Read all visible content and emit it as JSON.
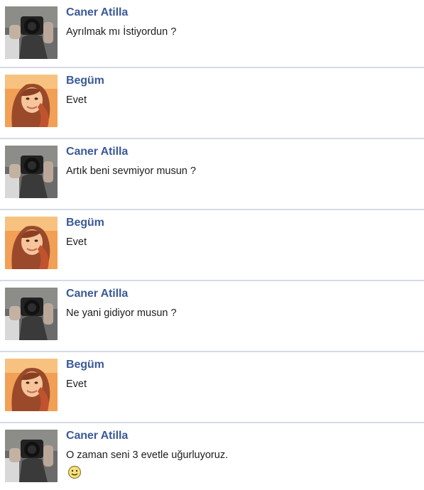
{
  "messages": [
    {
      "author": "Caner Atilla",
      "text": "Ayrılmak mı İstiyordun ?",
      "avatar_icon": "camera-man-avatar"
    },
    {
      "author": "Begüm",
      "text": "Evet",
      "avatar_icon": "girl-portrait-avatar"
    },
    {
      "author": "Caner Atilla",
      "text": "Artık beni sevmiyor musun ?",
      "avatar_icon": "camera-man-avatar"
    },
    {
      "author": "Begüm",
      "text": "Evet",
      "avatar_icon": "girl-portrait-avatar"
    },
    {
      "author": "Caner Atilla",
      "text": "Ne yani gidiyor musun ?",
      "avatar_icon": "camera-man-avatar"
    },
    {
      "author": "Begüm",
      "text": "Evet",
      "avatar_icon": "girl-portrait-avatar"
    },
    {
      "author": "Caner Atilla",
      "text": "O zaman seni 3 evetle uğurluyoruz.",
      "avatar_icon": "camera-man-avatar",
      "emoticon": "smiley-icon"
    }
  ],
  "colors": {
    "author_name": "#3b5998",
    "message_text": "#1c1c1c",
    "divider": "#d6dbe4",
    "background": "#ffffff"
  }
}
